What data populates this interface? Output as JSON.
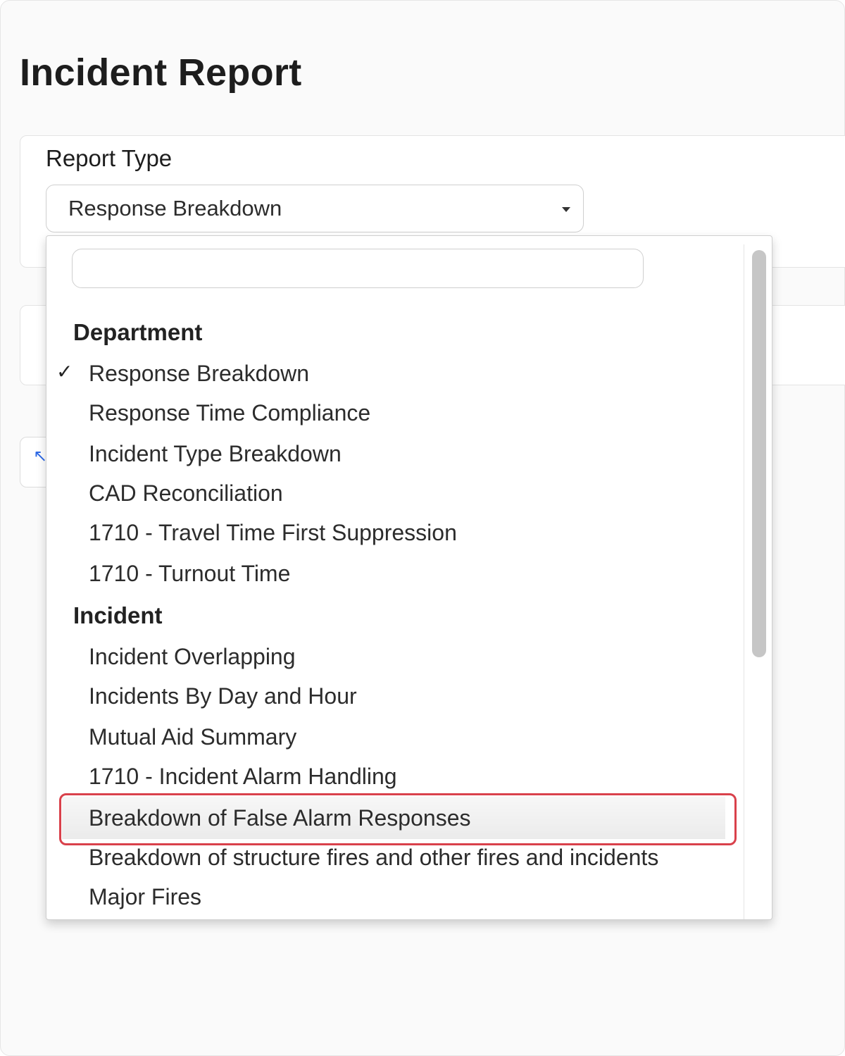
{
  "page": {
    "title": "Incident Report"
  },
  "report_type": {
    "label": "Report Type",
    "selected": "Response Breakdown",
    "search_placeholder": ""
  },
  "dropdown": {
    "groups": [
      {
        "label": "Department",
        "items": [
          {
            "label": "Response Breakdown",
            "selected": true
          },
          {
            "label": "Response Time Compliance"
          },
          {
            "label": "Incident Type Breakdown"
          },
          {
            "label": "CAD Reconciliation"
          },
          {
            "label": "1710 - Travel Time First Suppression"
          },
          {
            "label": "1710 - Turnout Time"
          }
        ]
      },
      {
        "label": "Incident",
        "items": [
          {
            "label": "Incident Overlapping"
          },
          {
            "label": "Incidents By Day and Hour"
          },
          {
            "label": "Mutual Aid Summary"
          },
          {
            "label": "1710 - Incident Alarm Handling"
          },
          {
            "label": "Breakdown of False Alarm Responses",
            "hovered": true
          },
          {
            "label": "Breakdown of structure fires and other fires and incidents"
          },
          {
            "label": "Major Fires"
          }
        ]
      }
    ]
  },
  "icons": {
    "checkmark": "✓",
    "caret": "caret-down-icon",
    "back_arrow": "↖"
  },
  "colors": {
    "annotation": "#d9414b",
    "accent": "#2f6ae5"
  }
}
